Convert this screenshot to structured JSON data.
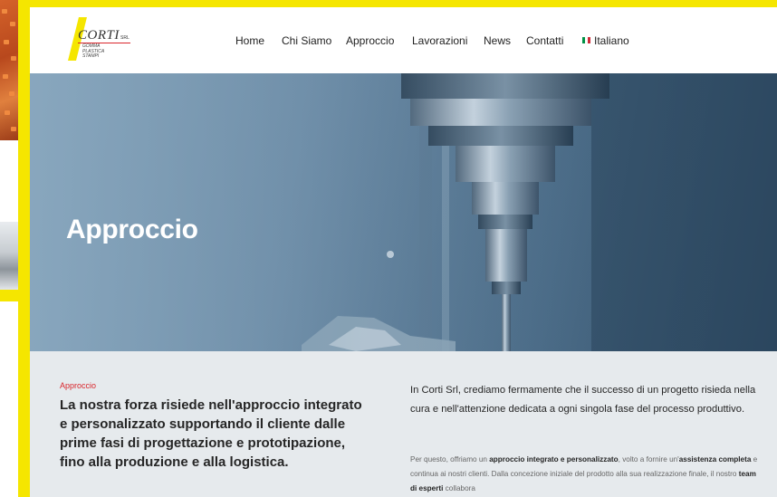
{
  "brand": {
    "name": "CORTI",
    "suffix": "SRL",
    "tagline": [
      "GOMMA",
      "PLASTICA",
      "STAMPI"
    ],
    "accent_color": "#f5e600",
    "line_color": "#d9262c"
  },
  "nav": {
    "items": [
      "Home",
      "Chi Siamo",
      "Approccio",
      "Lavorazioni",
      "News",
      "Contatti"
    ],
    "language": {
      "label": "Italiano",
      "icon": "italian-flag-icon"
    }
  },
  "hero": {
    "title": "Approccio"
  },
  "content": {
    "kicker": "Approccio",
    "lead": "La nostra forza risiede nell'approccio integrato e personalizzato supportando il cliente dalle prime fasi di progettazione e prototipazione, fino alla produzione e alla logistica.",
    "intro": "In Corti Srl, crediamo fermamente che il successo di un progetto risieda nella cura e nell'attenzione dedicata a ogni singola fase del processo produttivo.",
    "body": [
      "Per questo, offriamo un ",
      "approccio integrato e personalizzato",
      ", volto a fornire un'",
      "assistenza completa",
      " e continua ai nostri clienti. Dalla concezione iniziale del prodotto alla sua realizzazione finale, il nostro ",
      "team di esperti",
      " collabora"
    ]
  },
  "colors": {
    "page_background": "#f5e600",
    "content_background": "#e6eaed",
    "kicker": "#d9262c"
  }
}
